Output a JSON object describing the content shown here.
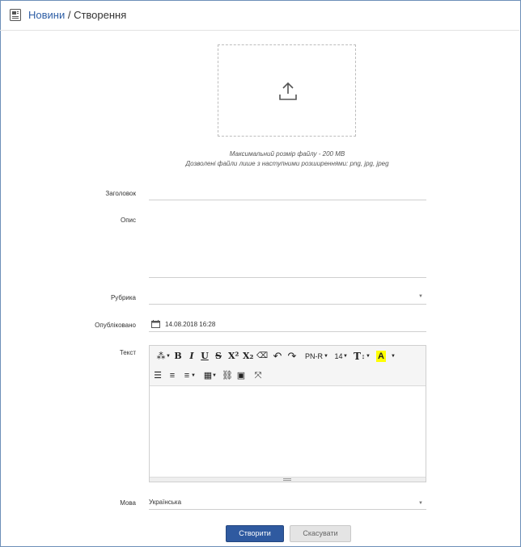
{
  "header": {
    "link": "Новини",
    "separator": " / ",
    "current": "Створення"
  },
  "upload": {
    "hint_size": "Максимальний розмір файлу - 200 MB",
    "hint_types": "Дозволені файли лише з наступними розширеннями: png, jpg, jpeg"
  },
  "form": {
    "title_label": "Заголовок",
    "title_value": "",
    "description_label": "Опис",
    "description_value": "",
    "category_label": "Рубрика",
    "category_value": "",
    "published_label": "Опубліковано",
    "published_value": "14.08.2018 16:28",
    "text_label": "Текст",
    "language_label": "Мова",
    "language_value": "Українська"
  },
  "editor": {
    "font_name": "PN-R",
    "font_size": "14",
    "text_size_glyph": "T",
    "highlight_glyph": "A",
    "highlight_color": "#ffff00"
  },
  "buttons": {
    "create": "Створити",
    "cancel": "Скасувати"
  },
  "colors": {
    "primary": "#2f5aa0",
    "link": "#2e5ea5",
    "frame": "#6d8fb8"
  }
}
